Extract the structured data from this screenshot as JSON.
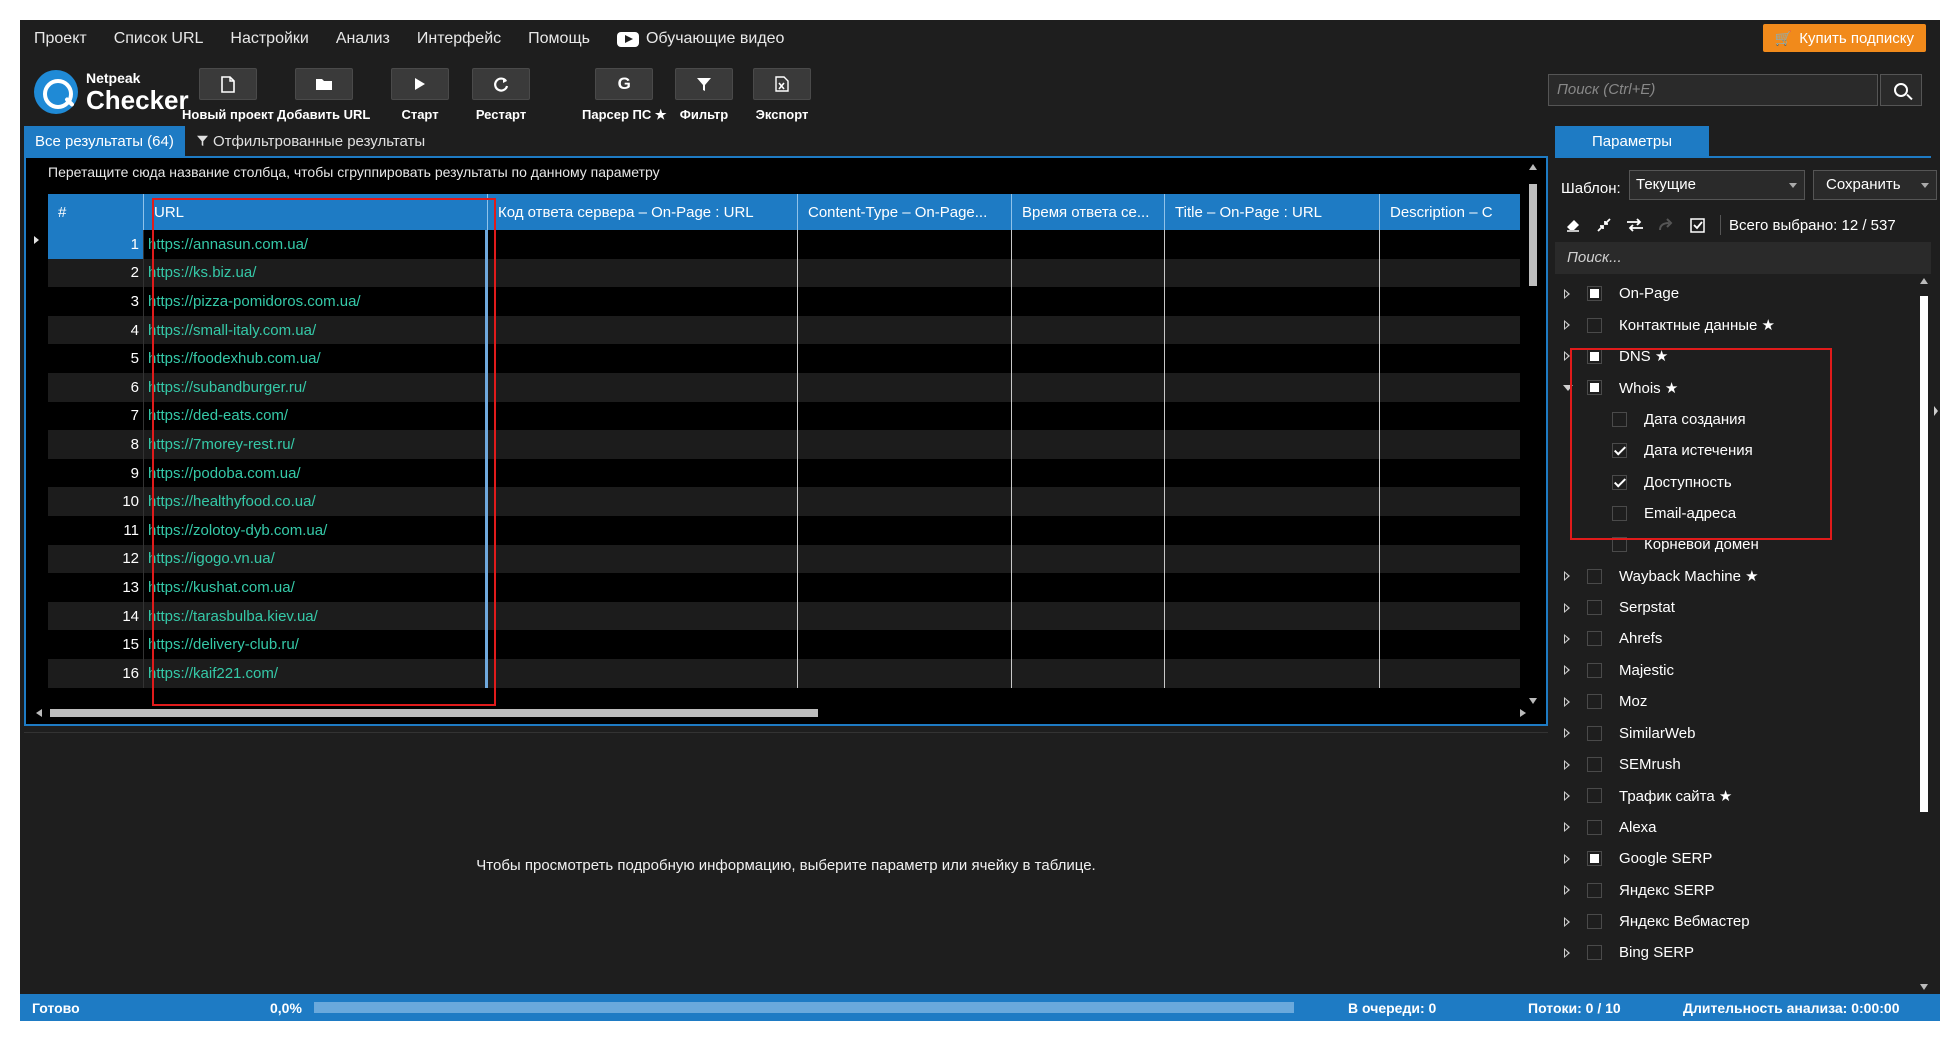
{
  "menu": {
    "items": [
      "Проект",
      "Список URL",
      "Настройки",
      "Анализ",
      "Интерфейс",
      "Помощь"
    ],
    "video_label": "Обучающие видео",
    "buy_label": "Купить подписку"
  },
  "logo": {
    "small": "Netpeak",
    "big": "Checker"
  },
  "toolbar": {
    "new_project": "Новый проект",
    "add_url": "Добавить URL",
    "start": "Старт",
    "restart": "Рестарт",
    "serp_parser": "Парсер ПС ★",
    "filter": "Фильтр",
    "export": "Экспорт",
    "search_placeholder": "Поиск (Ctrl+E)"
  },
  "tabs": {
    "all_results": "Все результаты (64)",
    "filtered_results": "Отфильтрованные результаты",
    "parameters": "Параметры"
  },
  "grid": {
    "group_hint": "Перетащите сюда название столбца, чтобы сгруппировать результаты по данному параметру",
    "columns": [
      {
        "label": "#"
      },
      {
        "label": "URL"
      },
      {
        "label": "Код ответа сервера  –  On-Page  :  URL"
      },
      {
        "label": "Content-Type  –  On-Page..."
      },
      {
        "label": "Время ответа се..."
      },
      {
        "label": "Title  –  On-Page  :  URL"
      },
      {
        "label": "Description  –  C"
      }
    ],
    "rows": [
      {
        "num": "1",
        "url": "https://annasun.com.ua/"
      },
      {
        "num": "2",
        "url": "https://ks.biz.ua/"
      },
      {
        "num": "3",
        "url": "https://pizza-pomidoros.com.ua/"
      },
      {
        "num": "4",
        "url": "https://small-italy.com.ua/"
      },
      {
        "num": "5",
        "url": "https://foodexhub.com.ua/"
      },
      {
        "num": "6",
        "url": "https://subandburger.ru/"
      },
      {
        "num": "7",
        "url": "https://ded-eats.com/"
      },
      {
        "num": "8",
        "url": "https://7morey-rest.ru/"
      },
      {
        "num": "9",
        "url": "https://podoba.com.ua/"
      },
      {
        "num": "10",
        "url": "https://healthyfood.co.ua/"
      },
      {
        "num": "11",
        "url": "https://zolotoy-dyb.com.ua/"
      },
      {
        "num": "12",
        "url": "https://igogo.vn.ua/"
      },
      {
        "num": "13",
        "url": "https://kushat.com.ua/"
      },
      {
        "num": "14",
        "url": "https://tarasbulba.kiev.ua/"
      },
      {
        "num": "15",
        "url": "https://delivery-club.ru/"
      },
      {
        "num": "16",
        "url": "https://kaif221.com/"
      }
    ]
  },
  "detail": {
    "hint": "Чтобы просмотреть подробную информацию, выберите параметр или ячейку в таблице."
  },
  "params": {
    "template_label": "Шаблон:",
    "template_value": "Текущие",
    "save_label": "Сохранить",
    "total_selected": "Всего выбрано: 12 / 537",
    "search_placeholder": "Поиск...",
    "tree": [
      {
        "label": "On-Page",
        "state": "partial",
        "level": 0,
        "expander": "closed"
      },
      {
        "label": "Контактные данные ★",
        "state": "none",
        "level": 0,
        "expander": "closed"
      },
      {
        "label": "DNS ★",
        "state": "partial",
        "level": 0,
        "expander": "closed"
      },
      {
        "label": "Whois ★",
        "state": "partial",
        "level": 0,
        "expander": "open"
      },
      {
        "label": "Дата создания",
        "state": "none",
        "level": 1
      },
      {
        "label": "Дата истечения",
        "state": "checked",
        "level": 1
      },
      {
        "label": "Доступность",
        "state": "checked",
        "level": 1
      },
      {
        "label": "Email-адреса",
        "state": "none",
        "level": 1
      },
      {
        "label": "Корневой домен",
        "state": "none",
        "level": 1
      },
      {
        "label": "Wayback Machine ★",
        "state": "none",
        "level": 0,
        "expander": "closed"
      },
      {
        "label": "Serpstat",
        "state": "none",
        "level": 0,
        "expander": "closed"
      },
      {
        "label": "Ahrefs",
        "state": "none",
        "level": 0,
        "expander": "closed"
      },
      {
        "label": "Majestic",
        "state": "none",
        "level": 0,
        "expander": "closed"
      },
      {
        "label": "Moz",
        "state": "none",
        "level": 0,
        "expander": "closed"
      },
      {
        "label": "SimilarWeb",
        "state": "none",
        "level": 0,
        "expander": "closed"
      },
      {
        "label": "SEMrush",
        "state": "none",
        "level": 0,
        "expander": "closed"
      },
      {
        "label": "Трафик сайта ★",
        "state": "none",
        "level": 0,
        "expander": "closed"
      },
      {
        "label": "Alexa",
        "state": "none",
        "level": 0,
        "expander": "closed"
      },
      {
        "label": "Google SERP",
        "state": "partial",
        "level": 0,
        "expander": "closed"
      },
      {
        "label": "Яндекс SERP",
        "state": "none",
        "level": 0,
        "expander": "closed"
      },
      {
        "label": "Яндекс Вебмастер",
        "state": "none",
        "level": 0,
        "expander": "closed"
      },
      {
        "label": "Bing SERP",
        "state": "none",
        "level": 0,
        "expander": "closed"
      }
    ]
  },
  "status": {
    "state": "Готово",
    "progress_label": "0,0%",
    "progress_fraction": 0,
    "queue": "В очереди: 0",
    "threads": "Потоки: 0 / 10",
    "duration": "Длительность анализа: 0:00:00"
  },
  "colors": {
    "accent": "#1e7bc4",
    "url_text": "#35c9a8",
    "buy_button": "#f18a1b",
    "highlight_box": "#e01b1b"
  },
  "icons": {
    "new_project": "file-icon",
    "add_url": "folder-icon",
    "start": "play-icon",
    "restart": "refresh-icon",
    "serp_parser": "google-g-icon",
    "filter": "funnel-icon",
    "export": "excel-icon"
  }
}
